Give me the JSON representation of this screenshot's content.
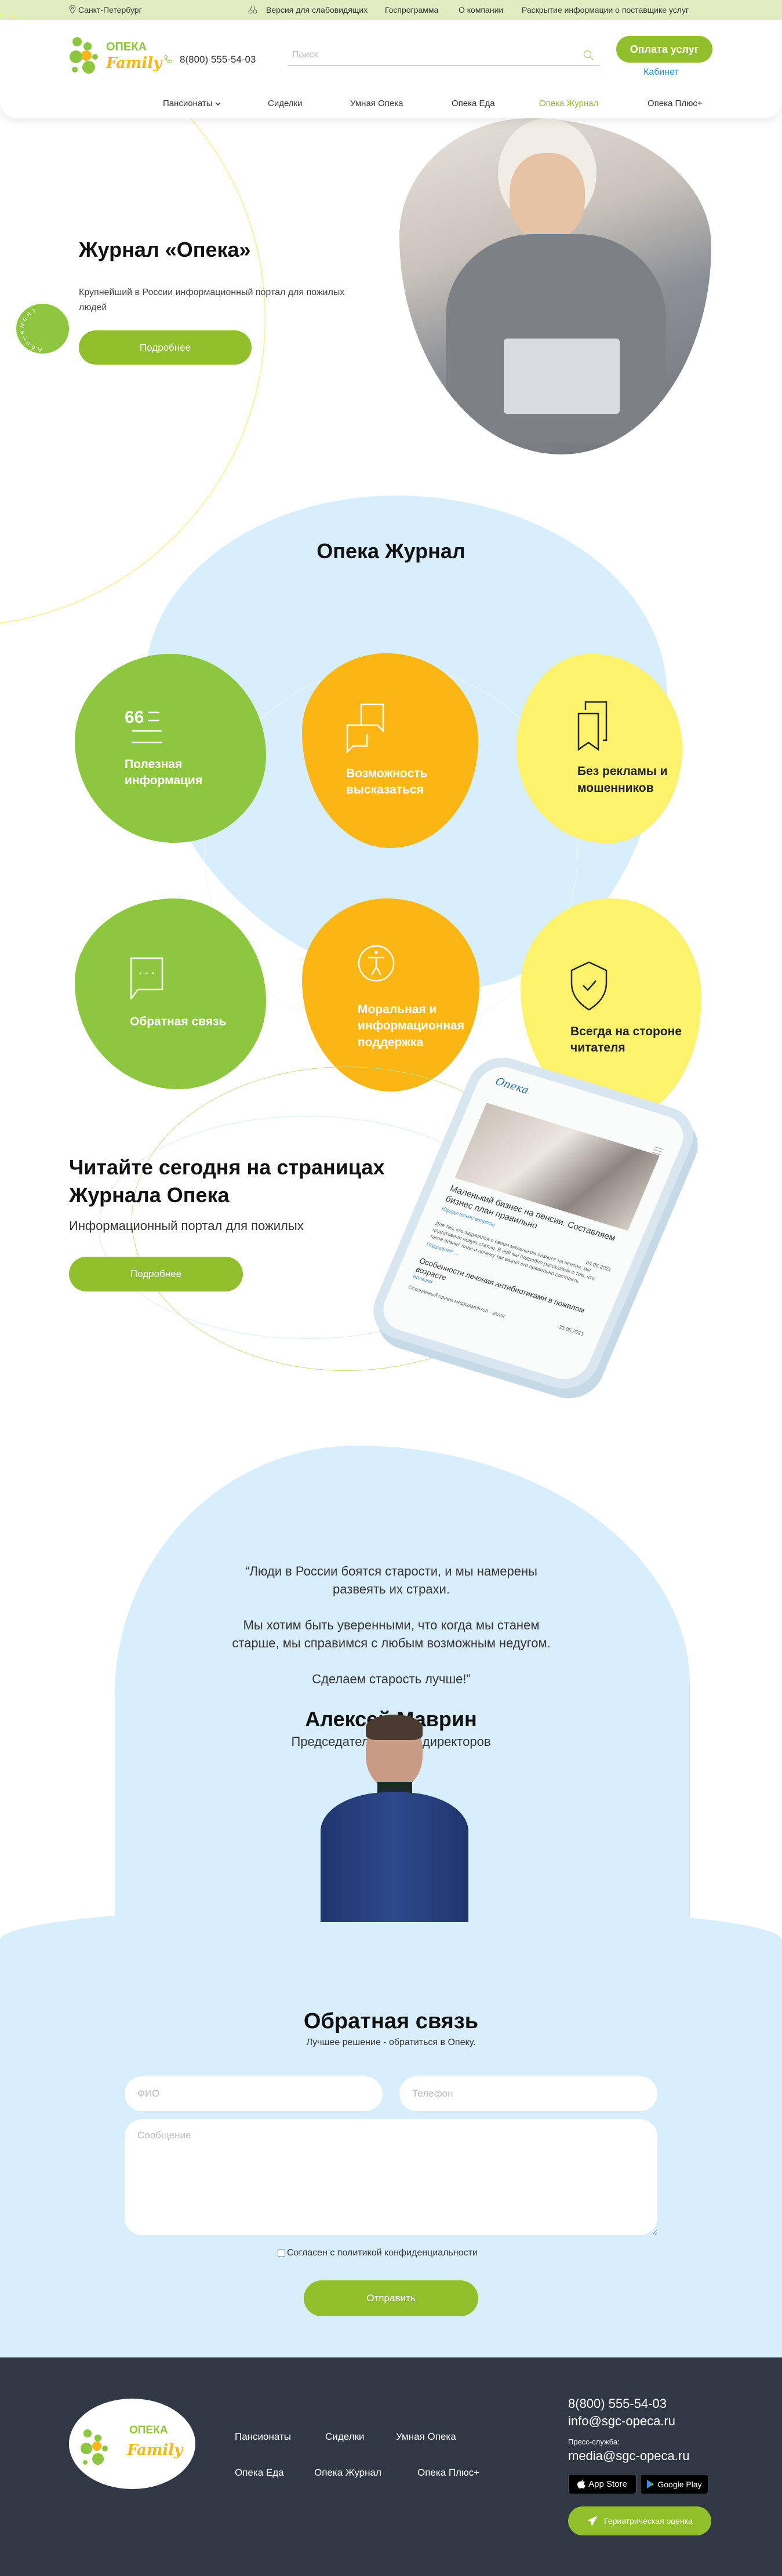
{
  "topbar": {
    "city": "Санкт-Петербург",
    "links": [
      "Версия для слабовидящих",
      "Госпрограмма",
      "О компании",
      "Раскрытие информации о поставщике услуг"
    ]
  },
  "header": {
    "logo_top": "ОПЕКА",
    "logo_bottom": "Family",
    "phone": "8(800) 555-54-03",
    "search_placeholder": "Поиск",
    "pay_button": "Оплата услуг",
    "cabinet_link": "Кабинет",
    "nav": [
      "Пансионаты",
      "Сиделки",
      "Умная Опека",
      "Опека Еда",
      "Опека Журнал",
      "Опека Плюс+"
    ],
    "active_nav": "Опека Журнал"
  },
  "hero": {
    "title": "Журнал «Опека»",
    "subtitle": "Крупнейший в России информационный портал для пожилых людей",
    "button": "Подробнее",
    "badge": "Абонемент"
  },
  "features": {
    "title": "Опека Журнал",
    "items": [
      {
        "label": "Полезная информация",
        "icon": "quote-lines-icon"
      },
      {
        "label": "Возможность высказаться",
        "icon": "chat-bubbles-icon"
      },
      {
        "label": "Без рекламы и мошенников",
        "icon": "bookmark-icon"
      },
      {
        "label": "Обратная связь",
        "icon": "message-dots-icon"
      },
      {
        "label": "Моральная и информационная поддержка",
        "icon": "accessibility-icon"
      },
      {
        "label": "Всегда на стороне читателя",
        "icon": "shield-check-icon"
      }
    ]
  },
  "read": {
    "title": "Читайте сегодня на страницах Журнала Опека",
    "subtitle": "Информационный портал для пожилых",
    "button": "Подробнее",
    "phone": {
      "logo": "Опека",
      "article1_title": "Маленький бизнес на пенсии. Составляем бизнес план правильно",
      "article1_category": "Юридические вопросы",
      "article1_date": "04.06.2021",
      "article1_excerpt": "Для тех, кто задумался о своем маленьком бизнесе на пенсии, мы подготовили новую статью. В ней мы подробно рассказали о том, что такое бизнес план и почему так важно его правильно составить.",
      "article1_more": "Подробнее ...",
      "article2_title": "Особенности лечения антибиотиками в пожилом возрасте",
      "article2_category": "Болезни",
      "article2_date": "30.05.2021",
      "article3_title": "Осознанный прием медикаментов - залог"
    }
  },
  "quote": {
    "p1": "“Люди в России боятся старости, и мы намерены развеять их страхи.",
    "p2": "Мы хотим быть уверенными, что когда мы станем старше, мы справимся с любым возможным недугом.",
    "p3": "Сделаем старость лучше!”",
    "name": "Алексей Маврин",
    "role": "Председатель совета директоров"
  },
  "feedback": {
    "title": "Обратная связь",
    "subtitle": "Лучшее решение - обратиться в Опеку.",
    "name_placeholder": "ФИО",
    "phone_placeholder": "Телефон",
    "message_placeholder": "Сообщение",
    "consent": "Согласен с политикой конфиденциальности",
    "submit": "Отправить"
  },
  "footer": {
    "links": [
      "Пансионаты",
      "Сиделки",
      "Умная Опека",
      "Опека Еда",
      "Опека Журнал",
      "Опека Плюс+"
    ],
    "phone": "8(800) 555-54-03",
    "email": "info@sgc-opeca.ru",
    "press_label": "Пресс-служба:",
    "press_email": "media@sgc-opeca.ru",
    "app_store": "App Store",
    "google_play": "Google Play",
    "geriatric_button": "Гериатрическая оценка"
  },
  "colors": {
    "green": "#91be2b",
    "blob_green": "#8dc63f",
    "orange": "#fbb614",
    "yellow": "#fdf26b",
    "light_blue": "#d8eefc",
    "footer": "#313845",
    "link_blue": "#2f8ee8"
  }
}
